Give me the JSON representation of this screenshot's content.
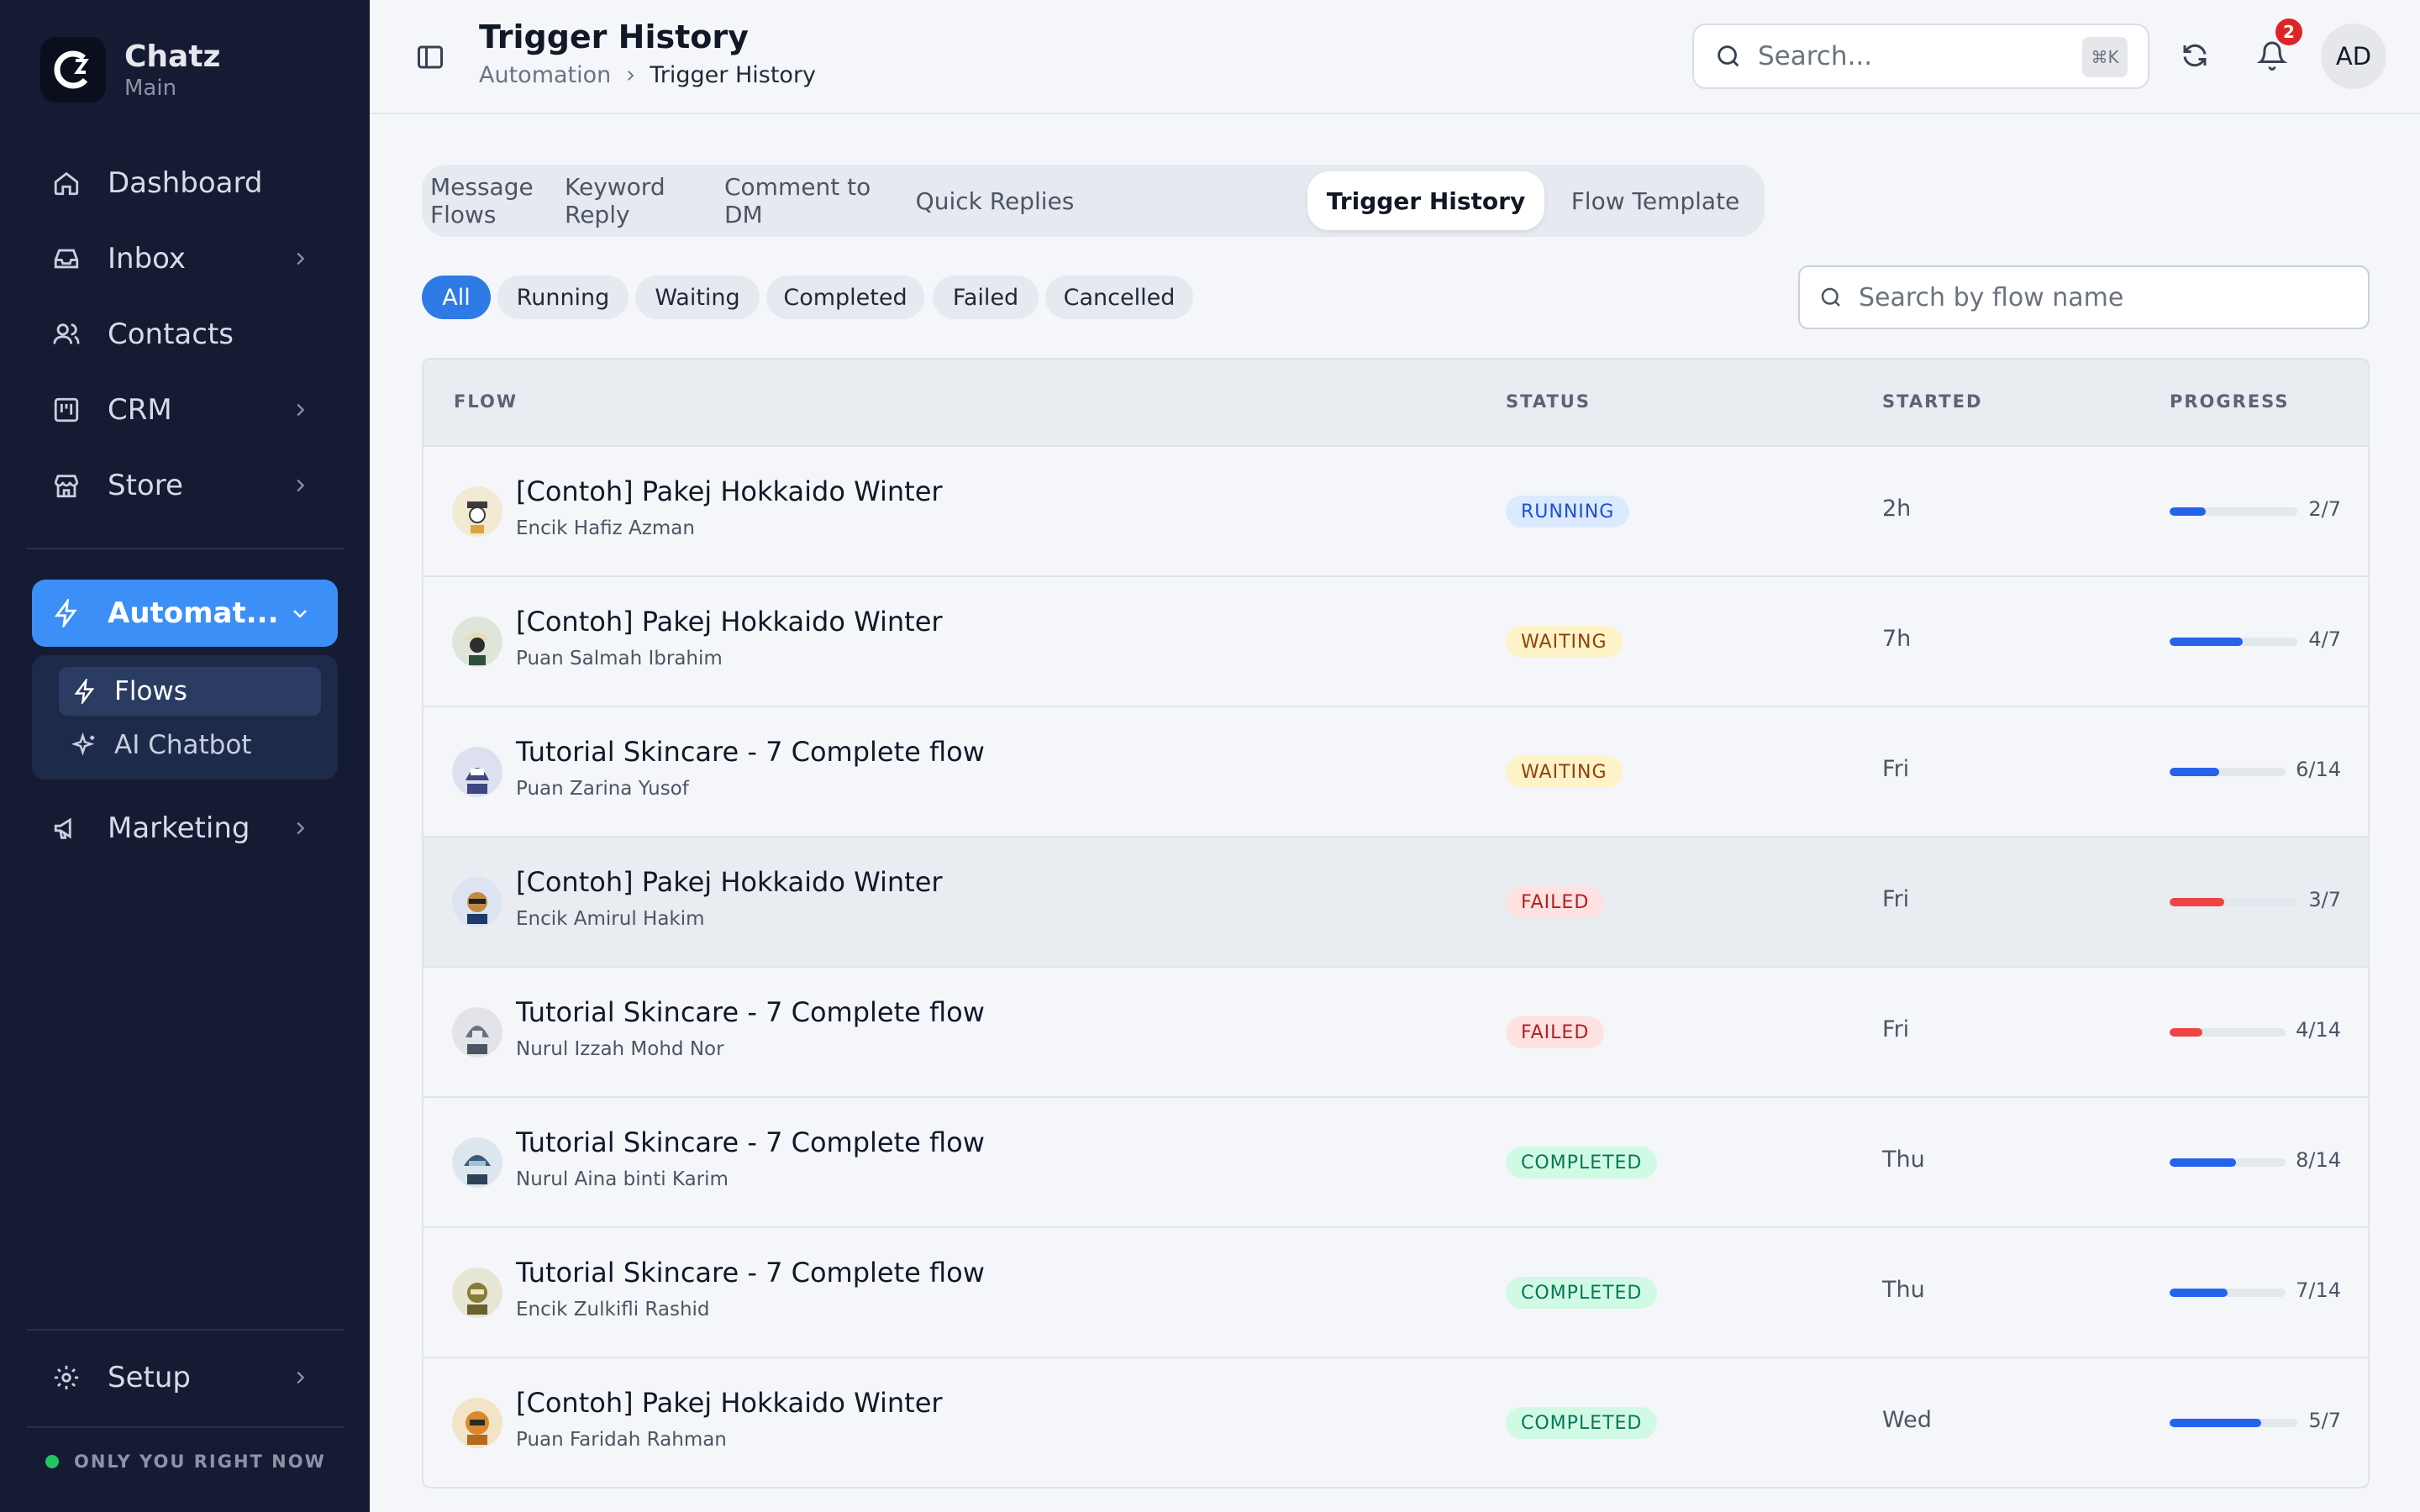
{
  "brand": {
    "name": "Chatz",
    "workspace": "Main"
  },
  "sidebar": {
    "items": [
      {
        "label": "Dashboard"
      },
      {
        "label": "Inbox"
      },
      {
        "label": "Contacts"
      },
      {
        "label": "CRM"
      },
      {
        "label": "Store"
      },
      {
        "label": "Automat..."
      },
      {
        "label": "Marketing"
      },
      {
        "label": "Setup"
      }
    ],
    "submenu": [
      {
        "label": "Flows"
      },
      {
        "label": "AI Chatbot"
      }
    ],
    "status": "ONLY YOU RIGHT NOW"
  },
  "header": {
    "title": "Trigger History",
    "breadcrumb": [
      "Automation",
      "Trigger History"
    ],
    "search_placeholder": "Search...",
    "search_shortcut": "⌘K",
    "notification_count": "2",
    "user_initials": "AD"
  },
  "tabs": [
    {
      "label": "Message Flows"
    },
    {
      "label": "Keyword Reply"
    },
    {
      "label": "Comment to DM"
    },
    {
      "label": "Quick Replies"
    },
    {
      "label": "Trigger History",
      "active": true
    },
    {
      "label": "Flow Template"
    }
  ],
  "filters": [
    {
      "label": "All",
      "active": true
    },
    {
      "label": "Running"
    },
    {
      "label": "Waiting"
    },
    {
      "label": "Completed"
    },
    {
      "label": "Failed"
    },
    {
      "label": "Cancelled"
    }
  ],
  "flow_search_placeholder": "Search by flow name",
  "table": {
    "headers": {
      "flow": "FLOW",
      "status": "STATUS",
      "started": "STARTED",
      "progress": "PROGRESS"
    },
    "rows": [
      {
        "flow": "[Contoh] Pakej Hokkaido Winter",
        "contact": "Encik Hafiz Azman",
        "status": "RUNNING",
        "started": "2h",
        "progress": "2/7",
        "progress_fraction": 0.2857
      },
      {
        "flow": "[Contoh] Pakej Hokkaido Winter",
        "contact": "Puan Salmah Ibrahim",
        "status": "WAITING",
        "started": "7h",
        "progress": "4/7",
        "progress_fraction": 0.5714
      },
      {
        "flow": "Tutorial Skincare - 7 Complete flow",
        "contact": "Puan Zarina Yusof",
        "status": "WAITING",
        "started": "Fri",
        "progress": "6/14",
        "progress_fraction": 0.4286
      },
      {
        "flow": "[Contoh] Pakej Hokkaido Winter",
        "contact": "Encik Amirul Hakim",
        "status": "FAILED",
        "started": "Fri",
        "progress": "3/7",
        "progress_fraction": 0.4286
      },
      {
        "flow": "Tutorial Skincare - 7 Complete flow",
        "contact": "Nurul Izzah Mohd Nor",
        "status": "FAILED",
        "started": "Fri",
        "progress": "4/14",
        "progress_fraction": 0.2857
      },
      {
        "flow": "Tutorial Skincare - 7 Complete flow",
        "contact": "Nurul Aina binti Karim",
        "status": "COMPLETED",
        "started": "Thu",
        "progress": "8/14",
        "progress_fraction": 0.5714
      },
      {
        "flow": "Tutorial Skincare - 7 Complete flow",
        "contact": "Encik Zulkifli Rashid",
        "status": "COMPLETED",
        "started": "Thu",
        "progress": "7/14",
        "progress_fraction": 0.5
      },
      {
        "flow": "[Contoh] Pakej Hokkaido Winter",
        "contact": "Puan Faridah Rahman",
        "status": "COMPLETED",
        "started": "Wed",
        "progress": "5/7",
        "progress_fraction": 0.7143
      }
    ]
  },
  "colors": {
    "accent": "#3b8ff6",
    "progress_blue": "#2563eb",
    "progress_red": "#ef4444",
    "sidebar_bg": "#141b33"
  }
}
